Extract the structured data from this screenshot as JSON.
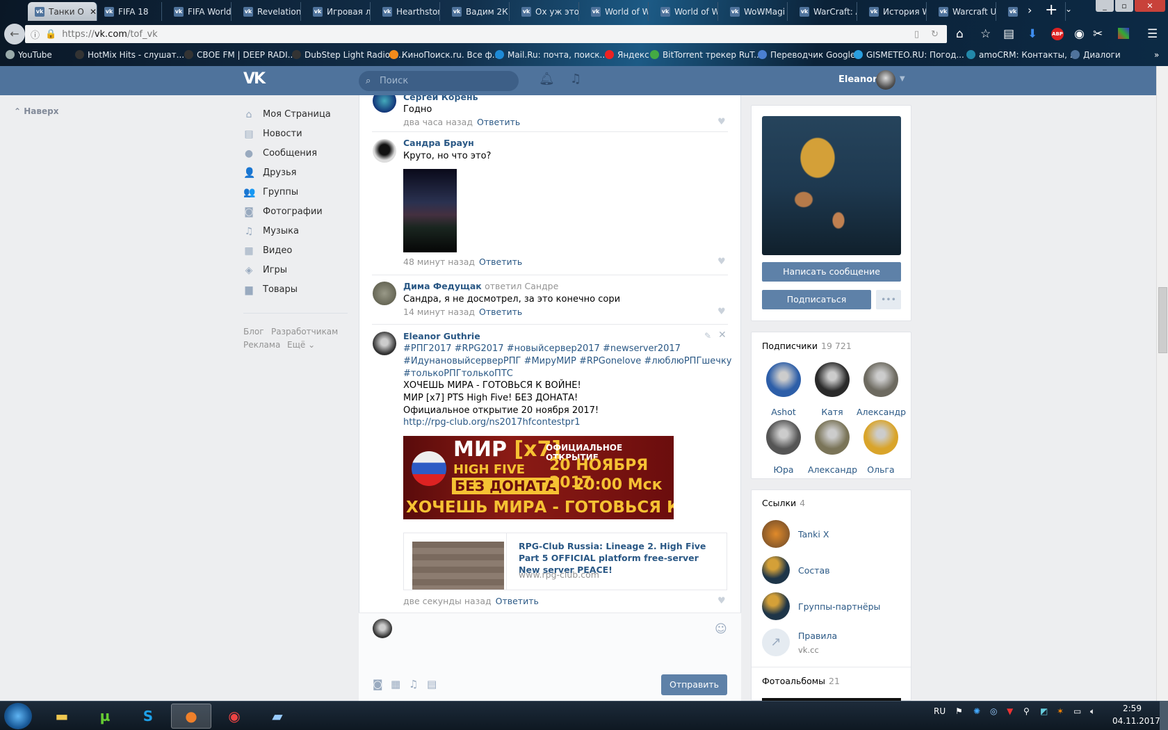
{
  "browser": {
    "tabs": [
      {
        "label": "Танки О",
        "active": true
      },
      {
        "label": "FIFA 18"
      },
      {
        "label": "FIFA World"
      },
      {
        "label": "Revelation"
      },
      {
        "label": "Игровая л"
      },
      {
        "label": "Hearthston"
      },
      {
        "label": "Вадим 2К"
      },
      {
        "label": "Ох уж этот"
      },
      {
        "label": "World of W"
      },
      {
        "label": "World of W"
      },
      {
        "label": "WoWMagi"
      },
      {
        "label": "WarCraft: A"
      },
      {
        "label": "История W"
      },
      {
        "label": "Warcraft U"
      },
      {
        "label": ""
      }
    ],
    "url_prefix": "https://",
    "url_host": "vk.com",
    "url_path": "/tof_vk",
    "bookmarks": [
      "YouTube",
      "HotMix Hits - слушат...",
      "СВОЕ FM | DEEP RADI...",
      "DubStep Light Radio -...",
      "КиноПоиск.ru. Все ф...",
      "Mail.Ru: почта, поиск...",
      "Яндекс",
      "BitTorrent трекер RuT...",
      "Переводчик Google",
      "GISMETEO.RU: Погод...",
      "amoCRM: Контакты, ...",
      "Диалоги"
    ],
    "bookmark_colors": [
      "#9aa",
      "#333",
      "#333",
      "#333",
      "#f28b1c",
      "#1e8ad6",
      "#e22",
      "#4a4",
      "#4a7fd0",
      "#2a9ee0",
      "#28a",
      "#4f739c"
    ]
  },
  "vk": {
    "header": {
      "search_placeholder": "Поиск",
      "user_name": "Eleanor"
    },
    "up_label": "Наверх",
    "nav": [
      {
        "label": "Моя Страница",
        "icon": "home-icon",
        "glyph": "⌂"
      },
      {
        "label": "Новости",
        "icon": "news-icon",
        "glyph": "▤"
      },
      {
        "label": "Сообщения",
        "icon": "messages-icon",
        "glyph": "●"
      },
      {
        "label": "Друзья",
        "icon": "friend-icon",
        "glyph": "👤"
      },
      {
        "label": "Группы",
        "icon": "groups-icon",
        "glyph": "👥"
      },
      {
        "label": "Фотографии",
        "icon": "camera-icon",
        "glyph": "◙"
      },
      {
        "label": "Музыка",
        "icon": "music-icon",
        "glyph": "♫"
      },
      {
        "label": "Видео",
        "icon": "video-icon",
        "glyph": "▦"
      },
      {
        "label": "Игры",
        "icon": "gamepad-icon",
        "glyph": "◈"
      },
      {
        "label": "Товары",
        "icon": "bag-icon",
        "glyph": "▆"
      }
    ],
    "footer": {
      "blog": "Блог",
      "dev": "Разработчикам",
      "ads": "Реклама",
      "more": "Ещё ⌄"
    },
    "comments": [
      {
        "name": "Сергей Корень",
        "text": "Годно",
        "time": "два часа назад",
        "reply": "Ответить"
      },
      {
        "name": "Сандра Браун",
        "text": "Круто, но что это?",
        "time": "48 минут назад",
        "reply": "Ответить"
      },
      {
        "name": "Дима Федущак",
        "replied_to": "ответил Сандре",
        "text": "Сандра, я не досмотрел, за это конечно сори",
        "time": "14 минут назад",
        "reply": "Ответить"
      },
      {
        "name": "Eleanor Guthrie",
        "tags_line1": "#РПГ2017 #RPG2017 #новыйсервер2017 #newserver2017",
        "tags_line2": "#ИдунановыйсерверРПГ #МируМИР #RPGonelove #люблюРПГшечку",
        "tags_line3": "#толькоРПГтолькоПТС",
        "line1": "ХОЧЕШЬ МИРА - ГОТОВЬСЯ К ВОЙНЕ!",
        "line2": "МИР [x7] PTS High Five! БЕЗ ДОНАТА!",
        "line3": "Официальное открытие 20 ноября 2017!",
        "link": "http://rpg-club.org/ns2017hfcontestpr1",
        "banner": {
          "t1": "МИР",
          "t1b": "[x7]",
          "t2": "HIGH FIVE",
          "t3": "БЕЗ ДОНАТА",
          "t4": "ОФИЦИАЛЬНОЕ ОТКРЫТИЕ",
          "t5": "20 НОЯБРЯ 2017",
          "t6": "20:00 Мск",
          "t7": "ХОЧЕШЬ МИРА - ГОТОВЬСЯ К ВОЙНЕ"
        },
        "card_title": "RPG-Club Russia: Lineage 2. High Five Part 5 OFFICIAL platform free-server New server PEACE!",
        "card_url": "www.rpg-club.com",
        "time": "две секунды назад",
        "reply": "Ответить"
      }
    ],
    "send_label": "Отправить",
    "profile": {
      "message_btn": "Написать сообщение",
      "subscribe_btn": "Подписаться",
      "more_btn": "•••"
    },
    "subscribers": {
      "title": "Подписчики",
      "count": "19 721",
      "people": [
        {
          "name": "Ashot",
          "color": "#2d5ea8"
        },
        {
          "name": "Катя",
          "color": "#2a2a2a"
        },
        {
          "name": "Александр",
          "color": "#6d6a60"
        },
        {
          "name": "Юра",
          "color": "#555"
        },
        {
          "name": "Александр",
          "color": "#7a7458"
        },
        {
          "name": "Ольга",
          "color": "#d9a42a"
        }
      ]
    },
    "links": {
      "title": "Ссылки",
      "count": "4",
      "items": [
        {
          "name": "Tanki X",
          "sub": ""
        },
        {
          "name": "Состав",
          "sub": ""
        },
        {
          "name": "Группы-партнёры",
          "sub": ""
        },
        {
          "name": "Правила",
          "sub": "vk.cc"
        }
      ]
    },
    "albums": {
      "title": "Фотоальбомы",
      "count": "21"
    }
  },
  "taskbar": {
    "lang": "RU",
    "time": "2:59",
    "date": "04.11.2017"
  }
}
